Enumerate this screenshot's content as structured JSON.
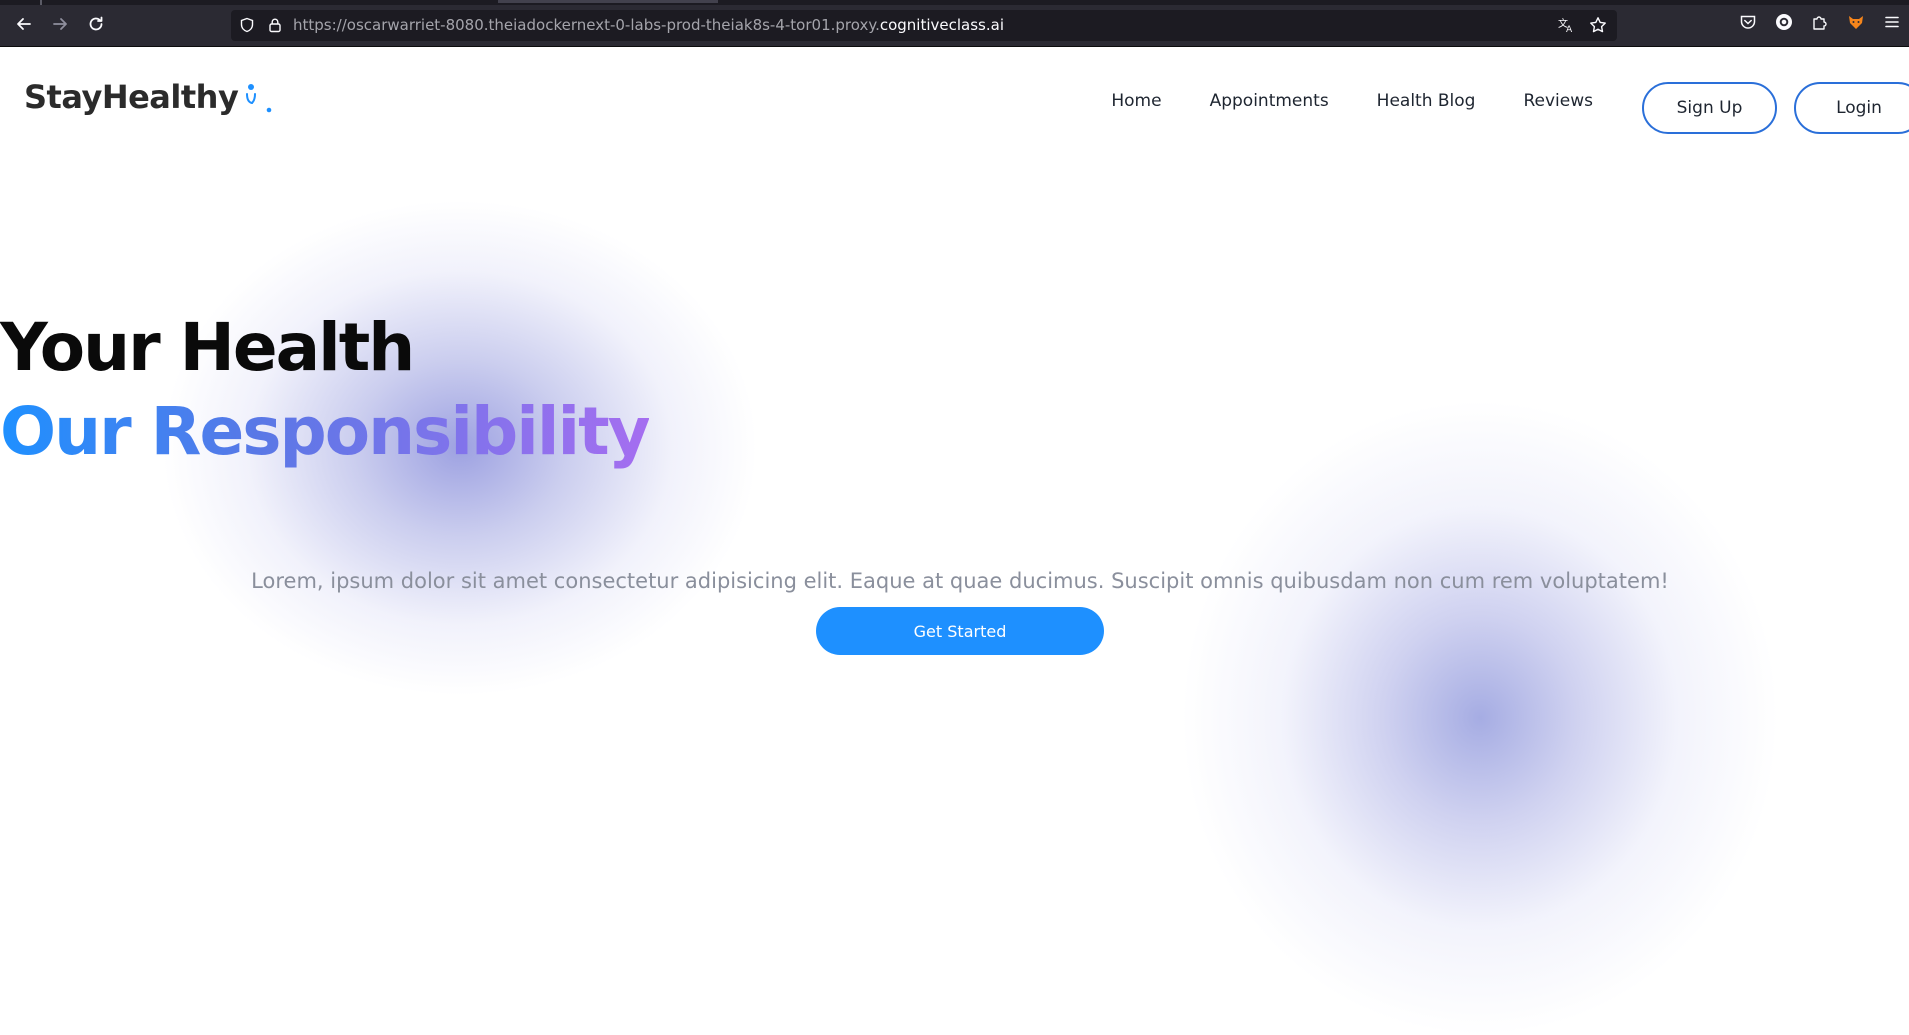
{
  "browser": {
    "url_dim_prefix": "https://oscarwarriet-8080.theiadockernext-0-labs-prod-theiak8s-4-tor01.proxy.",
    "url_host": "cognitiveclass.ai",
    "icons": [
      "back-arrow-icon",
      "forward-arrow-icon",
      "reload-icon",
      "shield-icon",
      "lock-icon",
      "translate-icon",
      "bookmark-star-icon",
      "pocket-icon",
      "profile-icon",
      "extensions-icon",
      "fox-extension-icon",
      "menu-icon"
    ]
  },
  "navbar": {
    "logo_text": "StayHealthy",
    "links": [
      "Home",
      "Appointments",
      "Health Blog",
      "Reviews"
    ],
    "signup_label": "Sign Up",
    "login_label": "Login"
  },
  "hero": {
    "title_line1": "Your Health",
    "title_line2": "Our Responsibility",
    "description": "Lorem, ipsum dolor sit amet consectetur adipisicing elit. Eaque at quae ducimus. Suscipit omnis quibusdam non cum rem voluptatem!",
    "cta_label": "Get Started"
  },
  "colors": {
    "accent": "#1e90ff",
    "gradient_end": "#a56ef0",
    "text_dark": "#0a0a0a",
    "text_muted": "#8a8f9c"
  }
}
